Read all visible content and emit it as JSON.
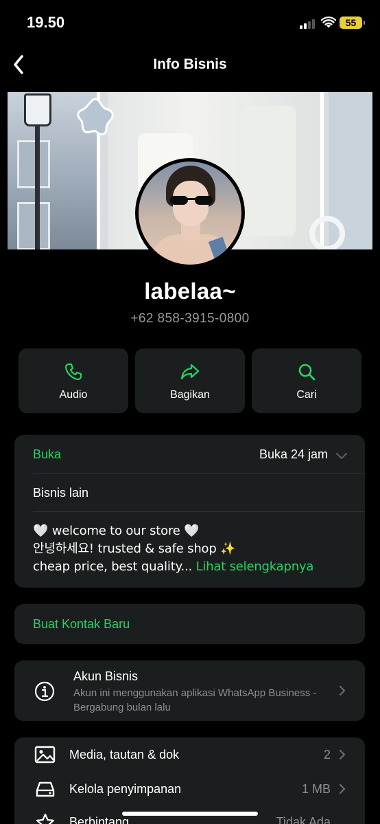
{
  "status_bar": {
    "time": "19.50",
    "battery": "55"
  },
  "nav": {
    "title": "Info Bisnis"
  },
  "profile": {
    "name": "labelaa~",
    "phone": "+62 858-3915-0800"
  },
  "actions": [
    {
      "label": "Audio",
      "icon": "phone-icon"
    },
    {
      "label": "Bagikan",
      "icon": "share-icon"
    },
    {
      "label": "Cari",
      "icon": "search-icon"
    }
  ],
  "hours": {
    "label": "Buka",
    "value": "Buka 24 jam"
  },
  "other_business": "Bisnis lain",
  "description": {
    "line1": "🤍 welcome to our store 🤍",
    "line2": "안녕하세요! trusted & safe shop ✨",
    "line3": "cheap price, best quality...",
    "more": "Lihat selengkapnya"
  },
  "new_contact": "Buat Kontak Baru",
  "business_account": {
    "title": "Akun Bisnis",
    "subtitle": "Akun ini menggunakan aplikasi WhatsApp Business - Bergabung bulan lalu"
  },
  "list": [
    {
      "label": "Media, tautan & dok",
      "value": "2",
      "icon": "image-icon"
    },
    {
      "label": "Kelola penyimpanan",
      "value": "1 MB",
      "icon": "storage-icon"
    },
    {
      "label": "Berbintang",
      "value": "Tidak Ada",
      "icon": "star-icon"
    }
  ],
  "colors": {
    "accent": "#25d366",
    "card": "#1b1e1e",
    "background": "#000000",
    "muted": "#8d8f8f"
  }
}
